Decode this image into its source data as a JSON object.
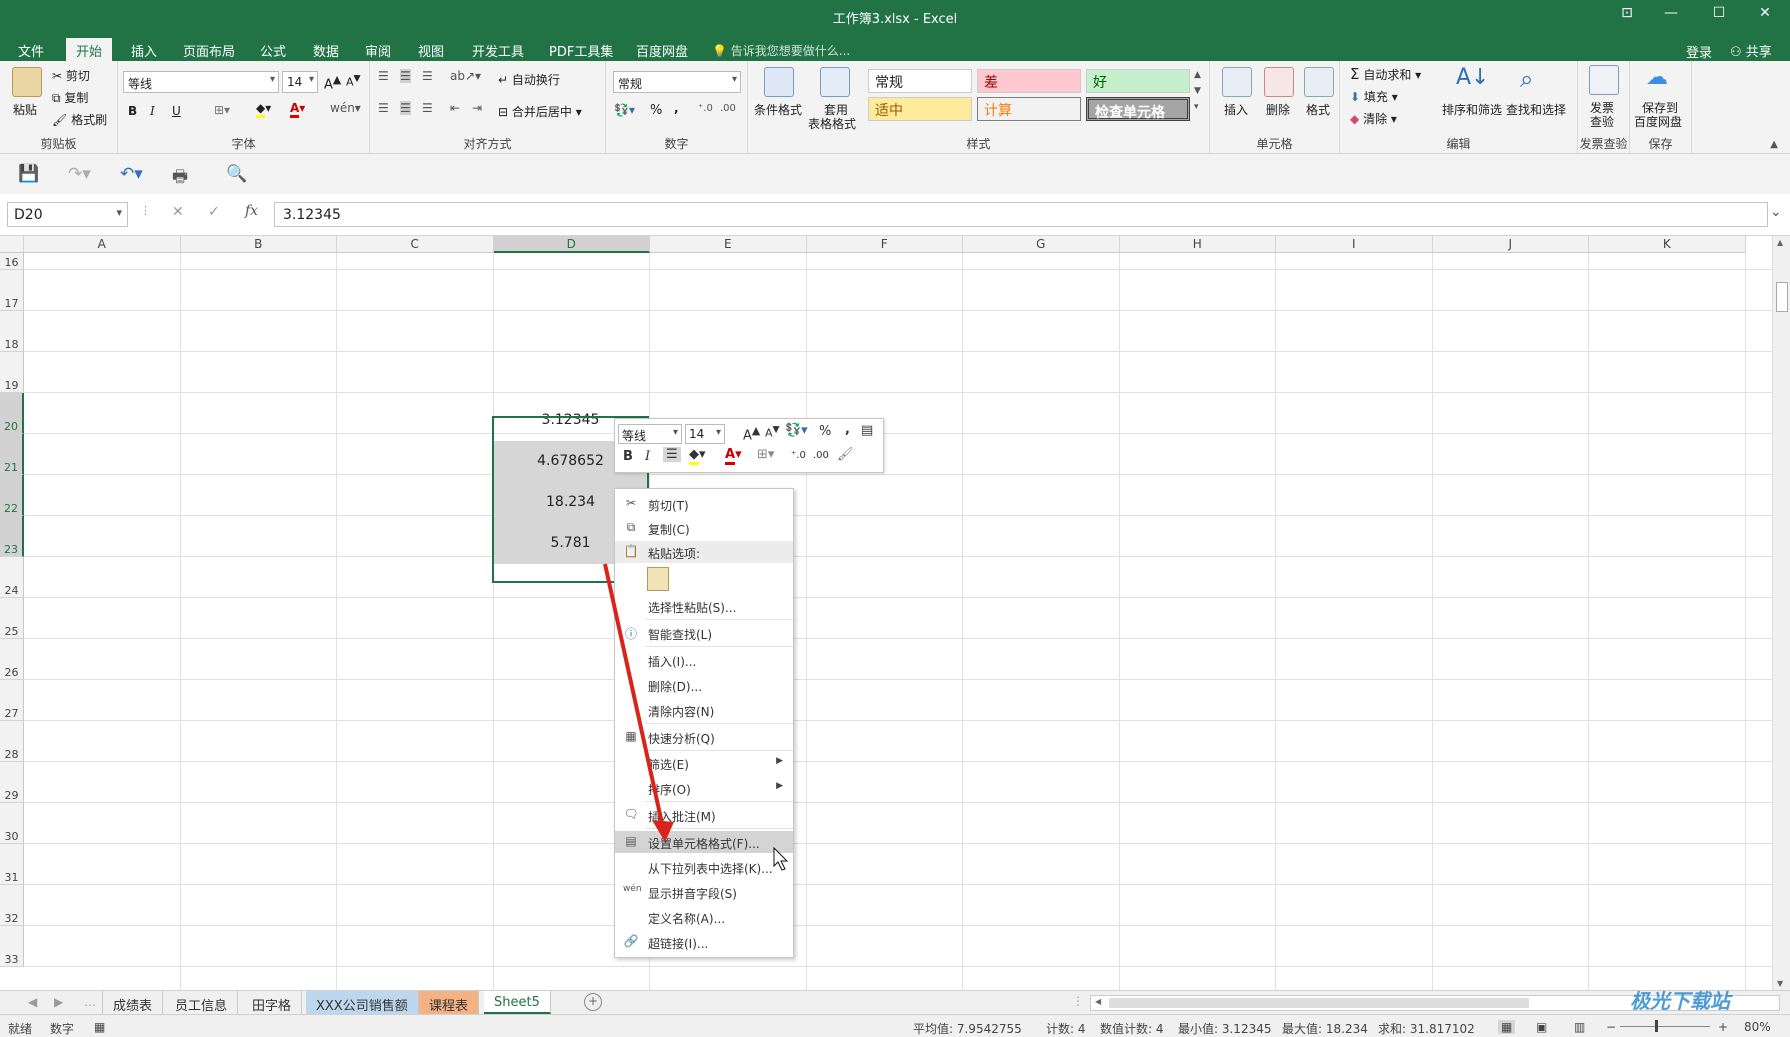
{
  "window": {
    "title": "工作簿3.xlsx - Excel"
  },
  "menu_tabs": [
    "文件",
    "开始",
    "插入",
    "页面布局",
    "公式",
    "数据",
    "审阅",
    "视图",
    "开发工具",
    "PDF工具集",
    "百度网盘"
  ],
  "tell_me": "告诉我您想要做什么...",
  "account": {
    "login": "登录",
    "share": "共享"
  },
  "ribbon": {
    "clipboard": {
      "label": "剪贴板",
      "paste": "粘贴",
      "cut": "剪切",
      "copy": "复制",
      "format_painter": "格式刷"
    },
    "font": {
      "label": "字体",
      "name": "等线",
      "size": "14",
      "bold": "B",
      "italic": "I",
      "underline": "U"
    },
    "alignment": {
      "label": "对齐方式",
      "wrap": "自动换行",
      "merge": "合并后居中"
    },
    "number": {
      "label": "数字",
      "format": "常规",
      "percent": "%",
      "comma": ","
    },
    "styles": {
      "label": "样式",
      "conditional": "条件格式",
      "table_format_1": "套用",
      "table_format_2": "表格格式",
      "cell_styles": [
        "常规",
        "差",
        "好",
        "适中",
        "计算",
        "检查单元格"
      ]
    },
    "cells": {
      "label": "单元格",
      "insert": "插入",
      "delete": "删除",
      "format": "格式"
    },
    "editing": {
      "label": "编辑",
      "autosum": "自动求和",
      "fill": "填充",
      "clear": "清除",
      "sort_filter": "排序和筛选",
      "find_select": "查找和选择"
    },
    "invoice": {
      "label": "发票查验",
      "btn_1": "发票",
      "btn_2": "查验"
    },
    "save_group": {
      "label": "保存",
      "btn_1": "保存到",
      "btn_2": "百度网盘"
    }
  },
  "formula_bar": {
    "name_box": "D20",
    "cancel": "✕",
    "enter": "✓",
    "fx": "fx",
    "value": "3.12345"
  },
  "columns": [
    "A",
    "B",
    "C",
    "D",
    "E",
    "F",
    "G",
    "H",
    "I",
    "J",
    "K"
  ],
  "rows": [
    "16",
    "17",
    "18",
    "19",
    "20",
    "21",
    "22",
    "23",
    "24",
    "25",
    "26",
    "27",
    "28",
    "29",
    "30",
    "31",
    "32",
    "33"
  ],
  "cells": [
    {
      "ref": "D20",
      "value": "3.12345"
    },
    {
      "ref": "D21",
      "value": "4.678652"
    },
    {
      "ref": "D22",
      "value": "18.234"
    },
    {
      "ref": "D23",
      "value": "5.781"
    }
  ],
  "mini_toolbar": {
    "font": "等线",
    "size": "14",
    "bold": "B",
    "italic": "I",
    "percent": "%",
    "comma": ","
  },
  "context_menu": [
    {
      "label": "剪切(T)",
      "icon": "scissors-icon"
    },
    {
      "label": "复制(C)",
      "icon": "copy-icon"
    },
    {
      "label": "粘贴选项:",
      "icon": "paste-icon"
    },
    {
      "label": "选择性粘贴(S)...",
      "icon": ""
    },
    {
      "label": "智能查找(L)",
      "icon": "info-icon"
    },
    {
      "label": "插入(I)...",
      "icon": ""
    },
    {
      "label": "删除(D)...",
      "icon": ""
    },
    {
      "label": "清除内容(N)",
      "icon": ""
    },
    {
      "label": "快速分析(Q)",
      "icon": "quick-analysis-icon"
    },
    {
      "label": "筛选(E)",
      "icon": ""
    },
    {
      "label": "排序(O)",
      "icon": ""
    },
    {
      "label": "插入批注(M)",
      "icon": "comment-icon"
    },
    {
      "label": "设置单元格格式(F)...",
      "icon": "format-cells-icon"
    },
    {
      "label": "从下拉列表中选择(K)...",
      "icon": ""
    },
    {
      "label": "显示拼音字段(S)",
      "icon": "phonetic-icon"
    },
    {
      "label": "定义名称(A)...",
      "icon": ""
    },
    {
      "label": "超链接(I)...",
      "icon": "hyperlink-icon"
    }
  ],
  "sheet_tabs": [
    "成绩表",
    "员工信息",
    "田字格",
    "XXX公司销售额",
    "课程表",
    "Sheet5"
  ],
  "status_bar": {
    "mode": "就绪",
    "num": "数字",
    "average": "平均值: 7.9542755",
    "count": "计数: 4",
    "numeric_count": "数值计数: 4",
    "min": "最小值: 3.12345",
    "max": "最大值: 18.234",
    "sum": "求和: 31.817102",
    "zoom": "80%"
  },
  "watermark": "极光下载站",
  "colors": {
    "accent": "#217346",
    "annotation_arrow": "#d9241b"
  }
}
